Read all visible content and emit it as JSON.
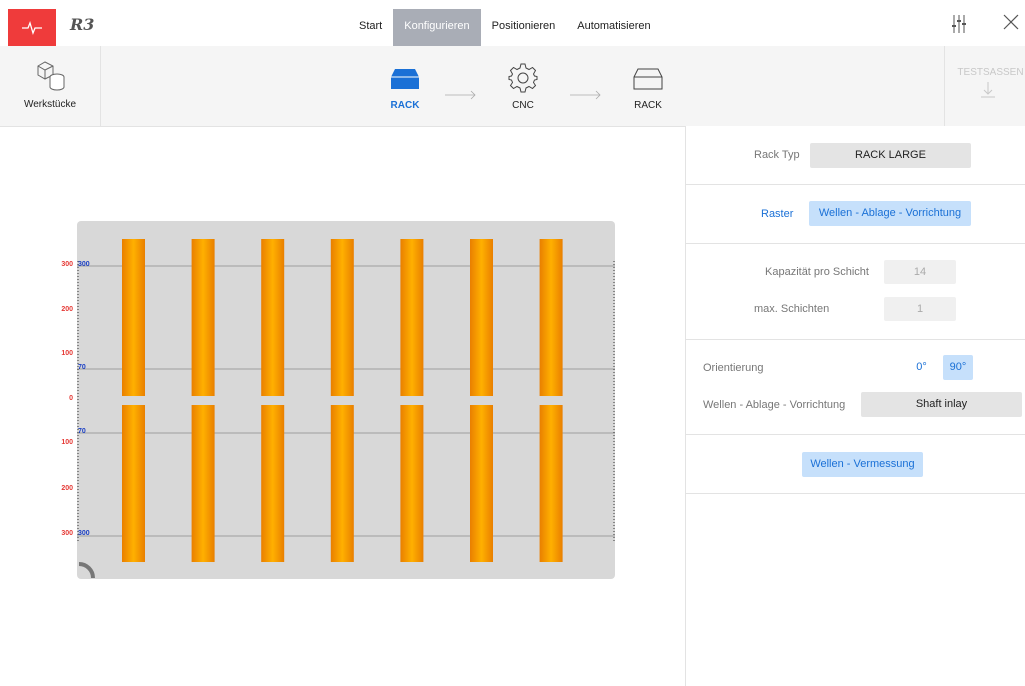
{
  "brand": "R3",
  "nav": {
    "tabs": [
      {
        "label": "Start"
      },
      {
        "label": "Konfigurieren"
      },
      {
        "label": "Positionieren"
      },
      {
        "label": "Automatisieren"
      }
    ]
  },
  "workflow": {
    "workpieces_label": "Werkstücke",
    "steps": [
      {
        "label": "RACK",
        "icon": "rack-filled-icon",
        "color": "#1a70d6"
      },
      {
        "label": "CNC",
        "icon": "gear-icon"
      },
      {
        "label": "RACK",
        "icon": "rack-outline-icon"
      }
    ],
    "test_label": "TESTSASSEN"
  },
  "panel": {
    "rack_type_label": "Rack Typ",
    "rack_type_value": "RACK LARGE",
    "raster_label": "Raster",
    "raster_value": "Wellen - Ablage - Vorrichtung",
    "capacity_label": "Kapazität pro Schicht",
    "capacity_value": "14",
    "layers_label": "max. Schichten",
    "layers_value": "1",
    "orientation_label": "Orientierung",
    "orientation_options": [
      "0°",
      "90°"
    ],
    "orientation_selected": "90°",
    "fixture_label": "Wellen - Ablage - Vorrichtung",
    "fixture_value": "Shaft inlay",
    "measure_button": "Wellen - Vermessung"
  },
  "rack": {
    "columns": 7,
    "rows": 2,
    "shaft_color": "#f7930a",
    "red_ticks": [
      "300",
      "200",
      "100",
      "0",
      "100",
      "200",
      "300"
    ],
    "blue_ticks": [
      "300",
      "70",
      "70",
      "300"
    ]
  },
  "colors": {
    "accent": "#1a70d6",
    "logo": "#ef3b3b"
  }
}
